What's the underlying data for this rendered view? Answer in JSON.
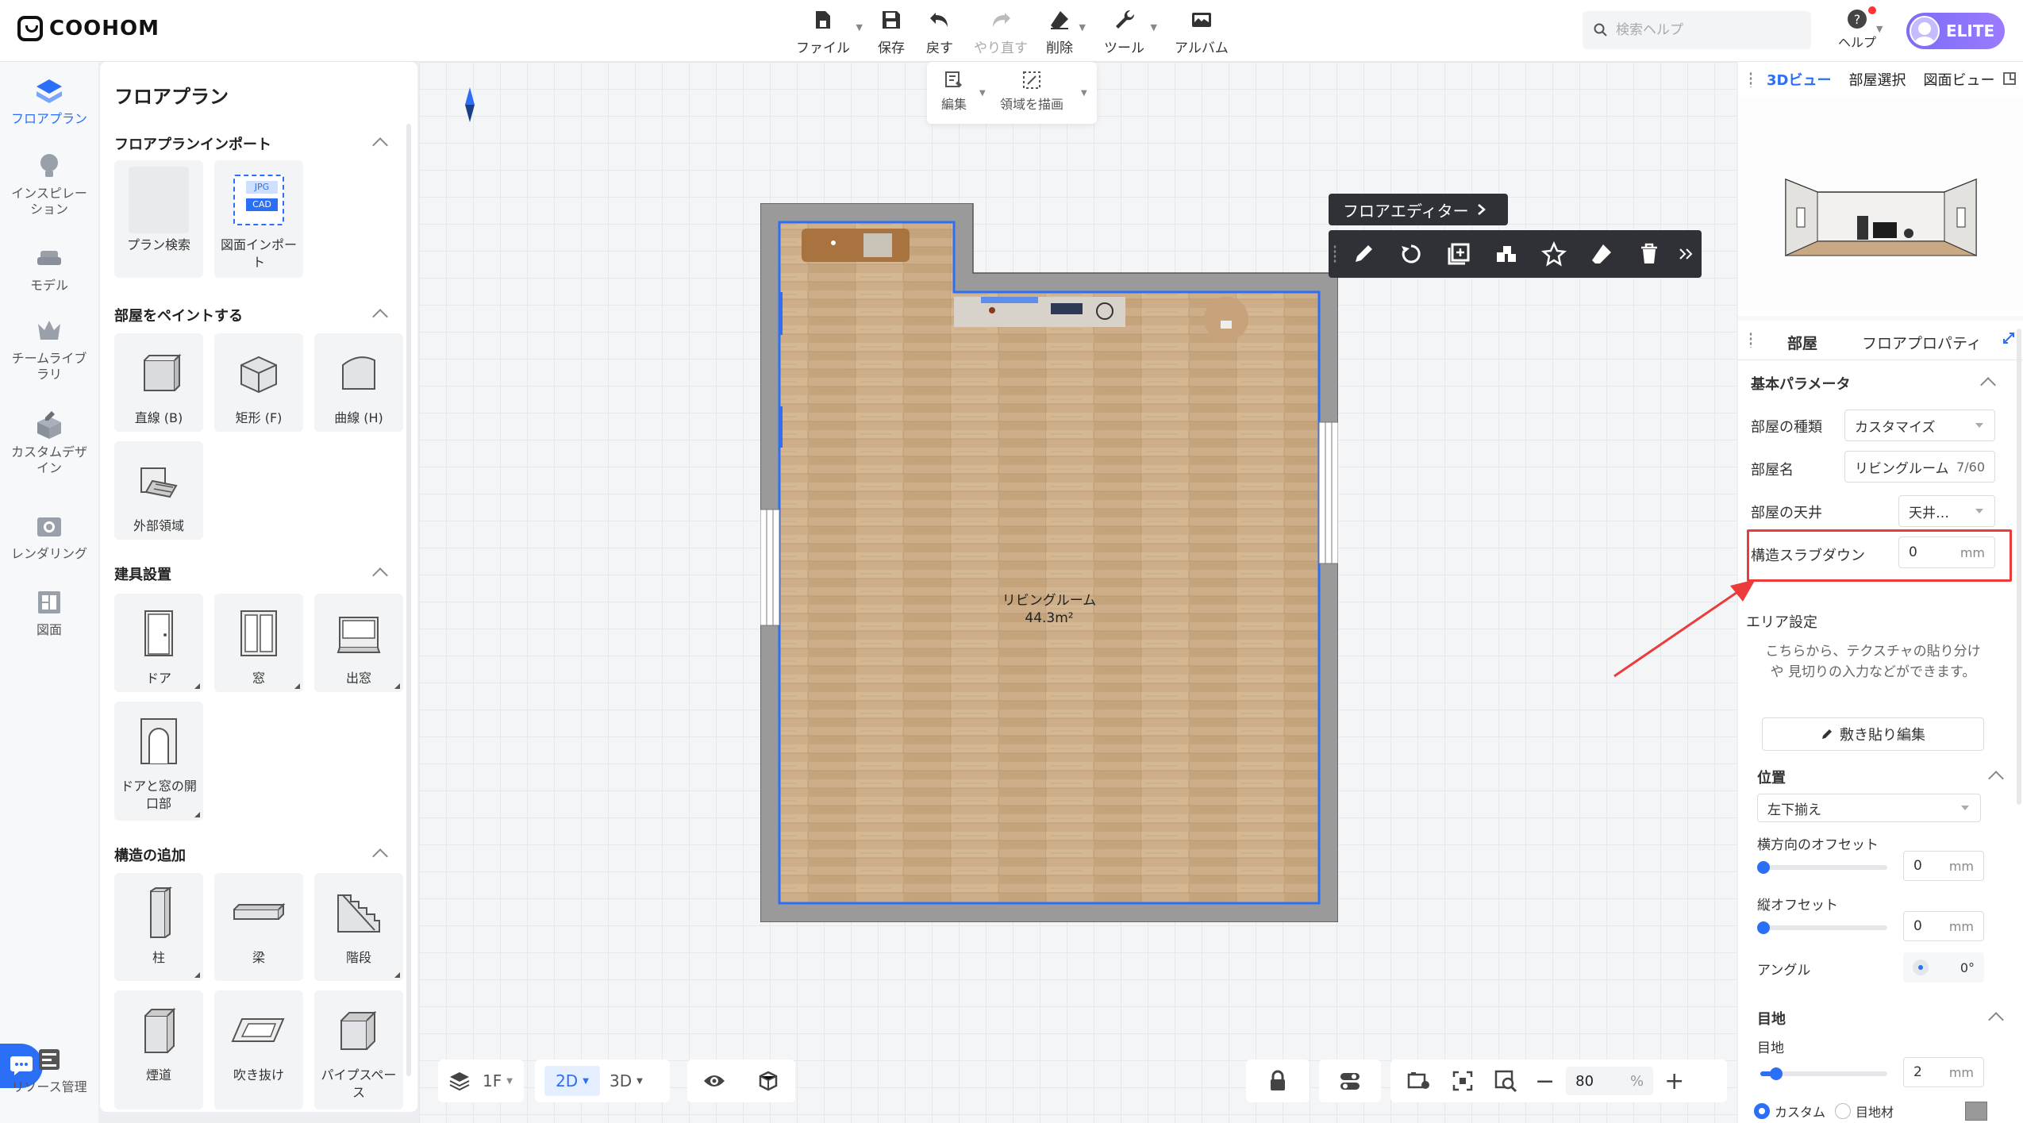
{
  "app": {
    "logo": "COOHOM"
  },
  "toolbar": {
    "file": "ファイル",
    "save": "保存",
    "undo": "戻す",
    "redo": "やり直す",
    "delete": "削除",
    "tools": "ツール",
    "album": "アルバム"
  },
  "search": {
    "placeholder": "検索ヘルプ"
  },
  "help": {
    "label": "ヘルプ"
  },
  "user": {
    "badge": "ELITE"
  },
  "leftnav": {
    "items": [
      {
        "label": "フロアプラン",
        "icon": "floorplan-icon"
      },
      {
        "label": "インスピレーション",
        "icon": "lightbulb-icon"
      },
      {
        "label": "モデル",
        "icon": "sofa-icon"
      },
      {
        "label": "チームライブラリ",
        "icon": "crown-icon"
      },
      {
        "label": "カスタムデザイン",
        "icon": "box-pencil-icon"
      },
      {
        "label": "レンダリング",
        "icon": "camera-icon"
      },
      {
        "label": "図面",
        "icon": "drawing-icon"
      }
    ],
    "resource": "リソース管理"
  },
  "panel": {
    "title": "フロアプラン",
    "import": {
      "title": "フロアプランインポート",
      "items": [
        "プラン検索",
        "図面インポート"
      ],
      "badge_jpg": "JPG",
      "badge_cad": "CAD"
    },
    "paint": {
      "title": "部屋をペイントする",
      "items": [
        "直線 (B)",
        "矩形 (F)",
        "曲線 (H)",
        "外部領域"
      ]
    },
    "fixtures": {
      "title": "建具設置",
      "items": [
        "ドア",
        "窓",
        "出窓",
        "ドアと窓の開口部"
      ]
    },
    "structure": {
      "title": "構造の追加",
      "items": [
        "柱",
        "梁",
        "階段",
        "煙道",
        "吹き抜け",
        "パイプスペース"
      ]
    }
  },
  "canvas_tools": {
    "edit": "編集",
    "draw_area": "領域を描画"
  },
  "floor_editor": {
    "label": "フロアエディター"
  },
  "room": {
    "name": "リビングルーム",
    "area": "44.3m²"
  },
  "bottom": {
    "floor": "1F",
    "view2d": "2D",
    "view3d": "3D",
    "zoom": "80",
    "zoom_unit": "%"
  },
  "right": {
    "view_tabs": [
      "3Dビュー",
      "部屋選択",
      "図面ビュー"
    ],
    "prop_tabs": [
      "部屋",
      "フロアプロパティ"
    ],
    "basic_params": "基本パラメータ",
    "room_type_label": "部屋の種類",
    "room_type_value": "カスタマイズ",
    "room_name_label": "部屋名",
    "room_name_value": "リビングルーム",
    "room_name_count": "7/60",
    "ceiling_label": "部屋の天井",
    "ceiling_value": "天井…",
    "slab_label": "構造スラブダウン",
    "slab_value": "0",
    "slab_unit": "mm",
    "area_settings": "エリア設定",
    "area_hint": "こちらから、テクスチャの貼り分けや 見切りの入力などができます。",
    "edit_paving": "敷き貼り編集",
    "position": "位置",
    "align_value": "左下揃え",
    "h_offset_label": "横方向のオフセット",
    "h_offset_value": "0",
    "v_offset_label": "縦オフセット",
    "v_offset_value": "0",
    "angle_label": "アングル",
    "angle_value": "0°",
    "joint_section": "目地",
    "joint_label": "目地",
    "joint_value": "2",
    "joint_fraction": 0.1,
    "unit": "mm",
    "custom_label": "カスタム",
    "joint_material_label": "目地材"
  },
  "colors": {
    "accent": "#2b6ff6",
    "highlight": "#ec3b3b",
    "wall": "#9a9a9a",
    "floor": "#c8a882"
  }
}
